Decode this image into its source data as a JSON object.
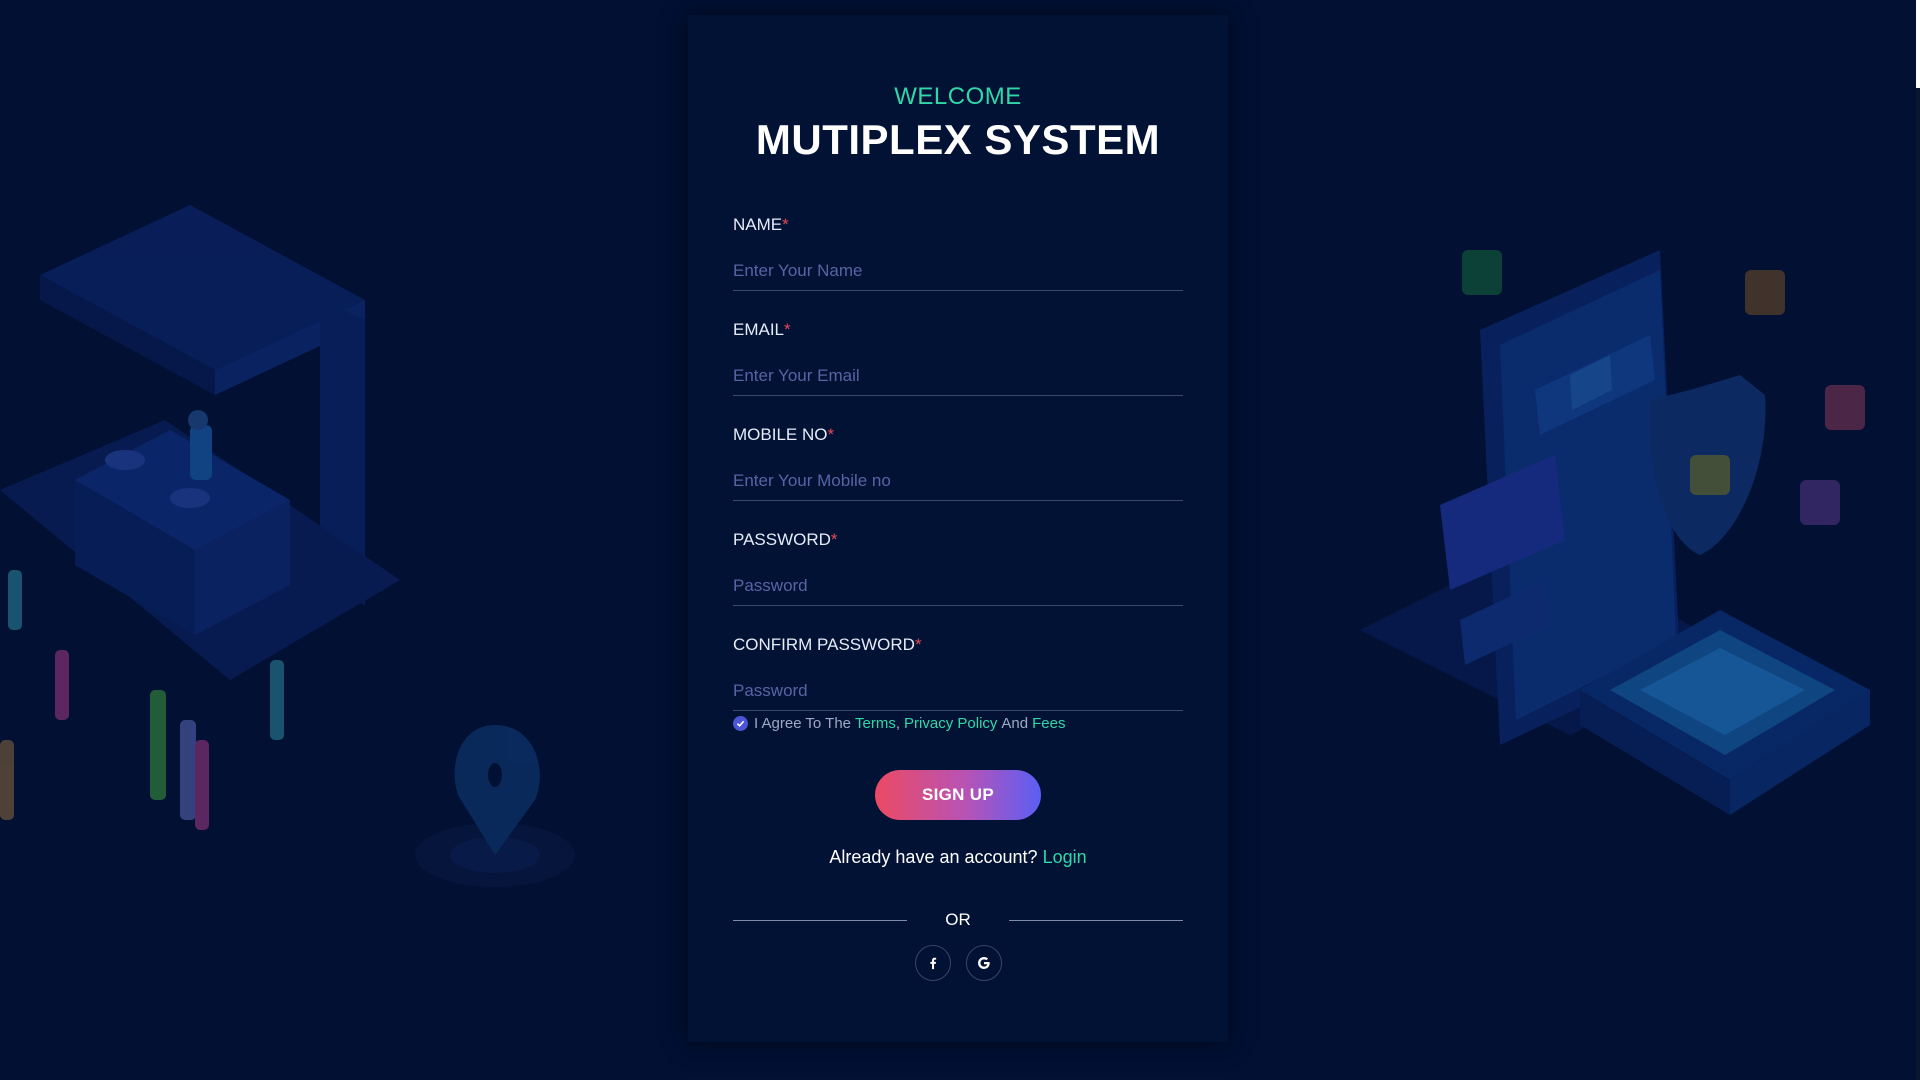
{
  "header": {
    "welcome": "WELCOME",
    "title": "MUTIPLEX SYSTEM"
  },
  "form": {
    "required_mark": "*",
    "fields": [
      {
        "label": "NAME",
        "placeholder": "Enter Your Name",
        "value": ""
      },
      {
        "label": "EMAIL",
        "placeholder": "Enter Your Email",
        "value": ""
      },
      {
        "label": "MOBILE NO",
        "placeholder": "Enter Your Mobile no",
        "value": ""
      },
      {
        "label": "PASSWORD",
        "placeholder": "Password",
        "value": ""
      },
      {
        "label": "CONFIRM PASSWORD",
        "placeholder": "Password",
        "value": ""
      }
    ],
    "agree": {
      "checked": true,
      "prefix": "I Agree To The",
      "terms": "Terms",
      "comma": ",",
      "privacy": "Privacy Policy",
      "and": "And",
      "fees": "Fees"
    },
    "signup_label": "SIGN UP"
  },
  "login_prompt": {
    "text": "Already have an account?",
    "link": "Login"
  },
  "divider": {
    "text": "OR"
  },
  "social": [
    {
      "icon": "facebook-icon",
      "glyph": "f"
    },
    {
      "icon": "google-icon",
      "glyph": "G"
    }
  ],
  "colors": {
    "background": "#011033",
    "card": "#021235",
    "accent": "#31d7a9",
    "required": "#e84855",
    "button_gradient_start": "#ec4a62",
    "button_gradient_end": "#5a5ff5"
  }
}
